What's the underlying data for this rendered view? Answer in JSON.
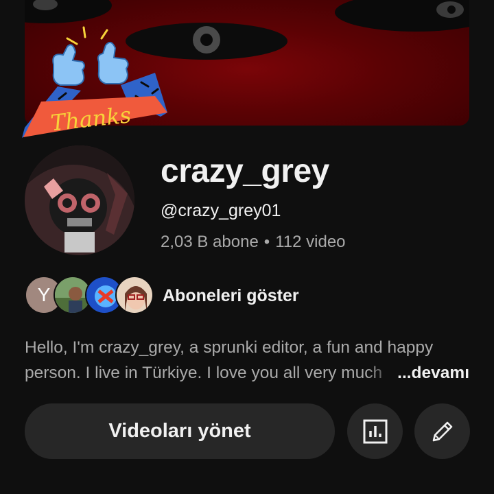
{
  "channel": {
    "name": "crazy_grey",
    "handle": "@crazy_grey01",
    "subscribers": "2,03 B abone",
    "separator": "•",
    "videos": "112 video"
  },
  "subscribers_preview": {
    "first_initial": "Y",
    "label": "Aboneleri göster"
  },
  "banner": {
    "sticker_text": "Thanks"
  },
  "description": {
    "line1": "Hello, I'm crazy_grey, a sprunki editor, a fun and happy",
    "line2": "person. I live in Türkiye. I love you all very much",
    "more_label": "...devamı"
  },
  "actions": {
    "manage_videos_label": "Videoları yönet",
    "analytics_icon": "bar-chart-icon",
    "edit_icon": "pencil-icon"
  },
  "colors": {
    "background": "#0f0f0f",
    "button": "#272727",
    "secondary_text": "#aaaaaa",
    "primary_text": "#f1f1f1"
  }
}
